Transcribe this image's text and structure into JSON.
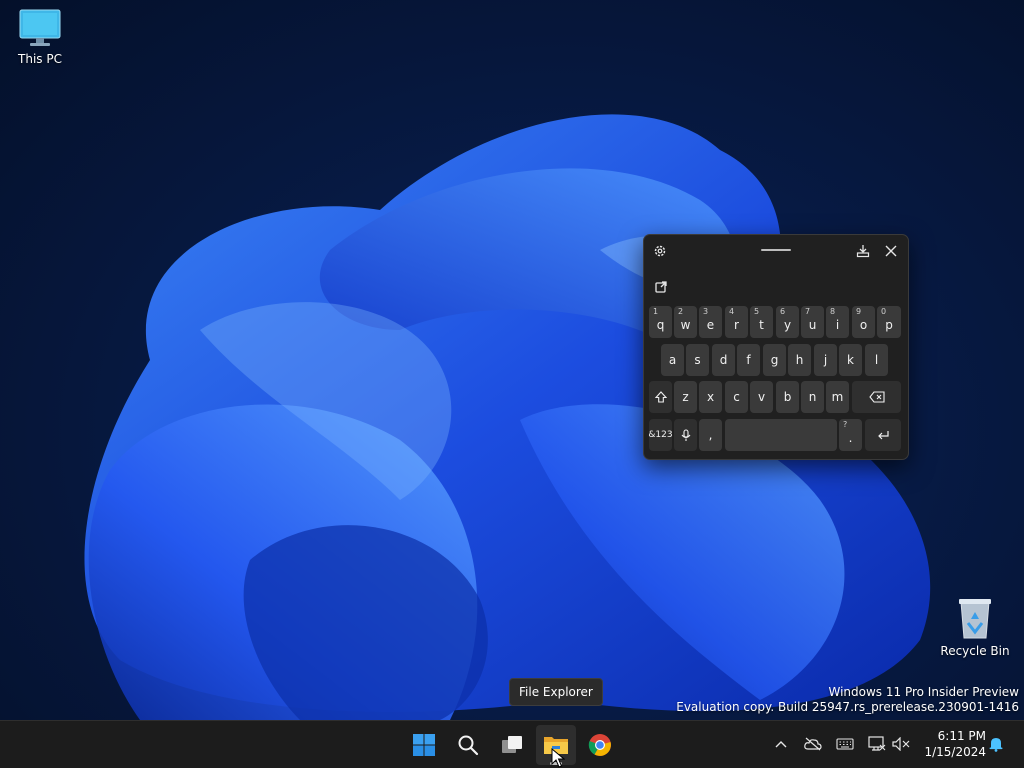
{
  "desktop": {
    "icons": [
      {
        "label": "This PC"
      },
      {
        "label": "Recycle Bin"
      }
    ],
    "watermark": {
      "line1": "Windows 11 Pro Insider Preview",
      "line2": "Evaluation copy. Build 25947.rs_prerelease.230901-1416"
    },
    "tooltip": "File Explorer"
  },
  "keyboard": {
    "rows": [
      {
        "keys": [
          {
            "label": "q",
            "hint": "1"
          },
          {
            "label": "w",
            "hint": "2"
          },
          {
            "label": "e",
            "hint": "3"
          },
          {
            "label": "r",
            "hint": "4"
          },
          {
            "label": "t",
            "hint": "5"
          },
          {
            "label": "y",
            "hint": "6"
          },
          {
            "label": "u",
            "hint": "7"
          },
          {
            "label": "i",
            "hint": "8"
          },
          {
            "label": "o",
            "hint": "9"
          },
          {
            "label": "p",
            "hint": "0"
          }
        ]
      },
      {
        "keys": [
          {
            "label": "a"
          },
          {
            "label": "s"
          },
          {
            "label": "d"
          },
          {
            "label": "f"
          },
          {
            "label": "g"
          },
          {
            "label": "h"
          },
          {
            "label": "j"
          },
          {
            "label": "k"
          },
          {
            "label": "l"
          }
        ]
      },
      {
        "keys": [
          {
            "label": "z"
          },
          {
            "label": "x"
          },
          {
            "label": "c"
          },
          {
            "label": "v"
          },
          {
            "label": "b"
          },
          {
            "label": "n"
          },
          {
            "label": "m"
          }
        ]
      }
    ],
    "symbols_label": "&123",
    "comma_label": ",",
    "period_label": ".",
    "period_hint": "?",
    "icons": {
      "settings": "gear-icon",
      "handle": "drag-handle",
      "dock": "dock-icon",
      "close": "close-icon",
      "clipboard": "clipboard-icon",
      "shift": "shift-icon",
      "backspace": "backspace-icon",
      "mic": "microphone-icon",
      "enter": "enter-icon"
    }
  },
  "taskbar": {
    "apps": [
      {
        "name": "Start",
        "icon": "windows-logo-icon"
      },
      {
        "name": "Search",
        "icon": "search-icon"
      },
      {
        "name": "Task View",
        "icon": "task-view-icon"
      },
      {
        "name": "File Explorer",
        "icon": "folder-icon",
        "active": true
      },
      {
        "name": "Google Chrome",
        "icon": "chrome-icon"
      }
    ],
    "tray": {
      "icons": [
        "chevron-up-icon",
        "cloud-off-icon",
        "keyboard-icon",
        "network-icon",
        "speaker-mute-icon",
        "bell-icon"
      ]
    },
    "clock": {
      "time": "6:11 PM",
      "date": "1/15/2024"
    }
  },
  "colors": {
    "accent": "#0067c0",
    "taskbar_bg": "#1c1c1c",
    "keyboard_bg": "#202020",
    "key_bg": "#3a3a3a"
  }
}
